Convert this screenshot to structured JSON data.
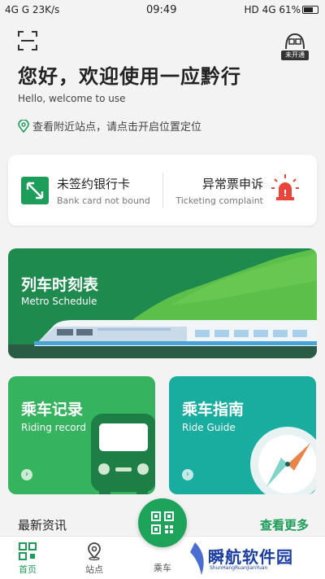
{
  "status_bar": {
    "left": "4G  G  23K/s",
    "time": "09:49",
    "right": "HD 4G 61%"
  },
  "header": {
    "greeting": "您好，欢迎使用一应黔行",
    "greeting_en": "Hello, welcome to use",
    "location_tip": "查看附近站点，请点击开启位置定位",
    "not_open_badge": "未开通"
  },
  "quick_cards": {
    "bank": {
      "title": "未签约银行卡",
      "subtitle": "Bank card not bound"
    },
    "complaint": {
      "title": "异常票申诉",
      "subtitle": "Ticketing complaint"
    }
  },
  "features": {
    "schedule": {
      "title": "列车时刻表",
      "subtitle": "Metro Schedule"
    },
    "riding": {
      "title": "乘车记录",
      "subtitle": "Riding record"
    },
    "guide": {
      "title": "乘车指南",
      "subtitle": "Ride Guide"
    }
  },
  "news": {
    "title": "最新资讯",
    "more": "查看更多"
  },
  "tabbar": {
    "home": "首页",
    "station": "站点",
    "ride": "乘车"
  },
  "watermark": {
    "text": "瞬航软件园",
    "sub": "ShunHangRuanJianYuan"
  },
  "colors": {
    "brand_green": "#1c9d5a",
    "riding_card": "#35b35e",
    "guide_card": "#19ada0",
    "alarm_red": "#e8453c"
  },
  "icons": [
    "scan-icon",
    "not-open-icon",
    "location-pin-icon",
    "bank-card-icon",
    "alarm-icon",
    "train-icon",
    "bus-icon",
    "compass-icon",
    "qr-code-icon",
    "home-icon",
    "station-pin-icon"
  ]
}
